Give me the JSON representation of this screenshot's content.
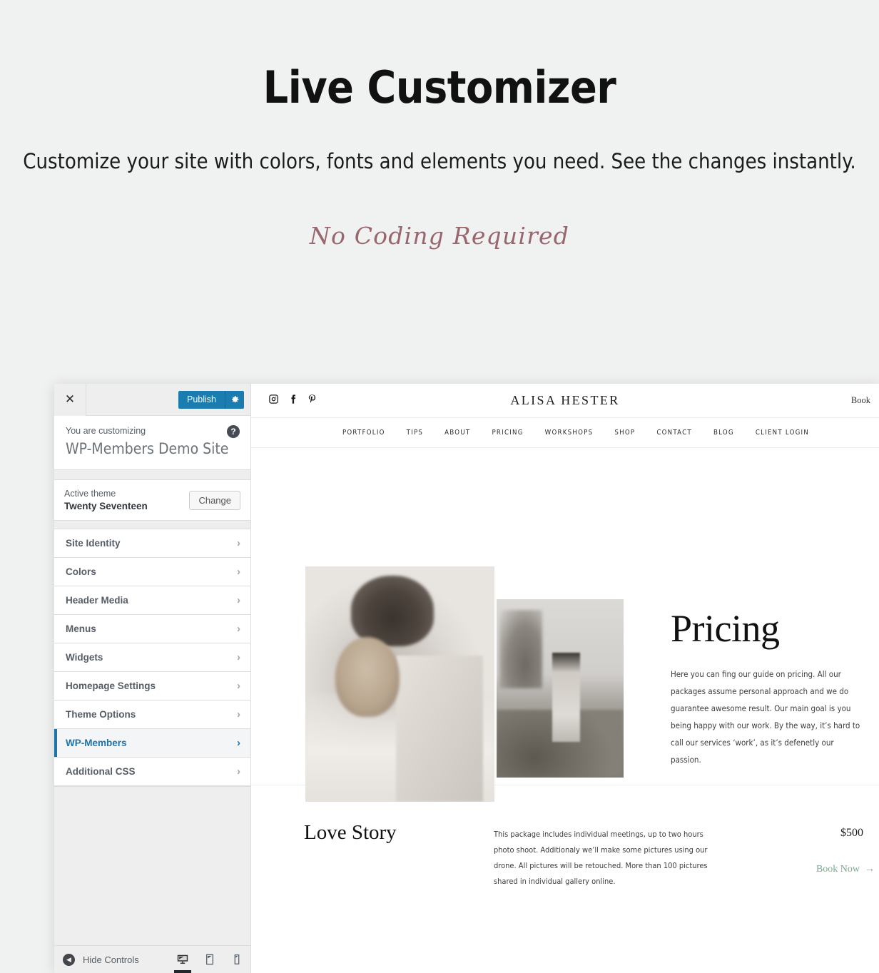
{
  "hero": {
    "title": "Live Customizer",
    "subtitle": "Customize your site with colors, fonts and elements you need. See the changes instantly.",
    "script_line": "No Coding Required",
    "script_color": "#99666d"
  },
  "customizer": {
    "topbar": {
      "close_icon": "close-icon",
      "publish_label": "Publish",
      "gear_icon": "gear-icon",
      "accent_color": "#1b7cb0"
    },
    "customizing": {
      "label": "You are customizing",
      "site_name": "WP-Members Demo Site",
      "help_icon": "help-icon"
    },
    "theme": {
      "label": "Active theme",
      "name": "Twenty Seventeen",
      "change_label": "Change"
    },
    "menu_items": [
      {
        "label": "Site Identity",
        "active": false
      },
      {
        "label": "Colors",
        "active": false
      },
      {
        "label": "Header Media",
        "active": false
      },
      {
        "label": "Menus",
        "active": false
      },
      {
        "label": "Widgets",
        "active": false
      },
      {
        "label": "Homepage Settings",
        "active": false
      },
      {
        "label": "Theme Options",
        "active": false
      },
      {
        "label": "WP-Members",
        "active": true
      },
      {
        "label": "Additional CSS",
        "active": false
      }
    ],
    "active_item_color": "#1e73a8",
    "footer": {
      "hide_controls_label": "Hide Controls",
      "devices": [
        {
          "name": "desktop-icon",
          "active": true
        },
        {
          "name": "tablet-icon",
          "active": false
        },
        {
          "name": "mobile-icon",
          "active": false
        }
      ]
    }
  },
  "preview": {
    "socials": [
      "instagram-icon",
      "facebook-icon",
      "pinterest-icon"
    ],
    "logo": "ALISA HESTER",
    "book_link": "Book",
    "nav": [
      "PORTFOLIO",
      "TIPS",
      "ABOUT",
      "PRICING",
      "WORKSHOPS",
      "SHOP",
      "CONTACT",
      "BLOG",
      "CLIENT LOGIN"
    ],
    "pricing": {
      "title": "Pricing",
      "body": "Here you can fing our guide on pricing. All our packages assume personal approach and we do guarantee awesome result. Our main goal is you being happy with our work. By the way, it’s hard to call our services ‘work’, as it’s defenetly our passion."
    },
    "package": {
      "title": "Love Story",
      "description": "This package includes individual meetings, up to two hours photo shoot. Additionaly we’ll make some pictures using our drone. All pictures will be retouched. More than 100 pictures shared in individual gallery online.",
      "price": "$500",
      "book_label": "Book Now",
      "book_arrow": "→",
      "book_color": "#7aa98f"
    }
  }
}
